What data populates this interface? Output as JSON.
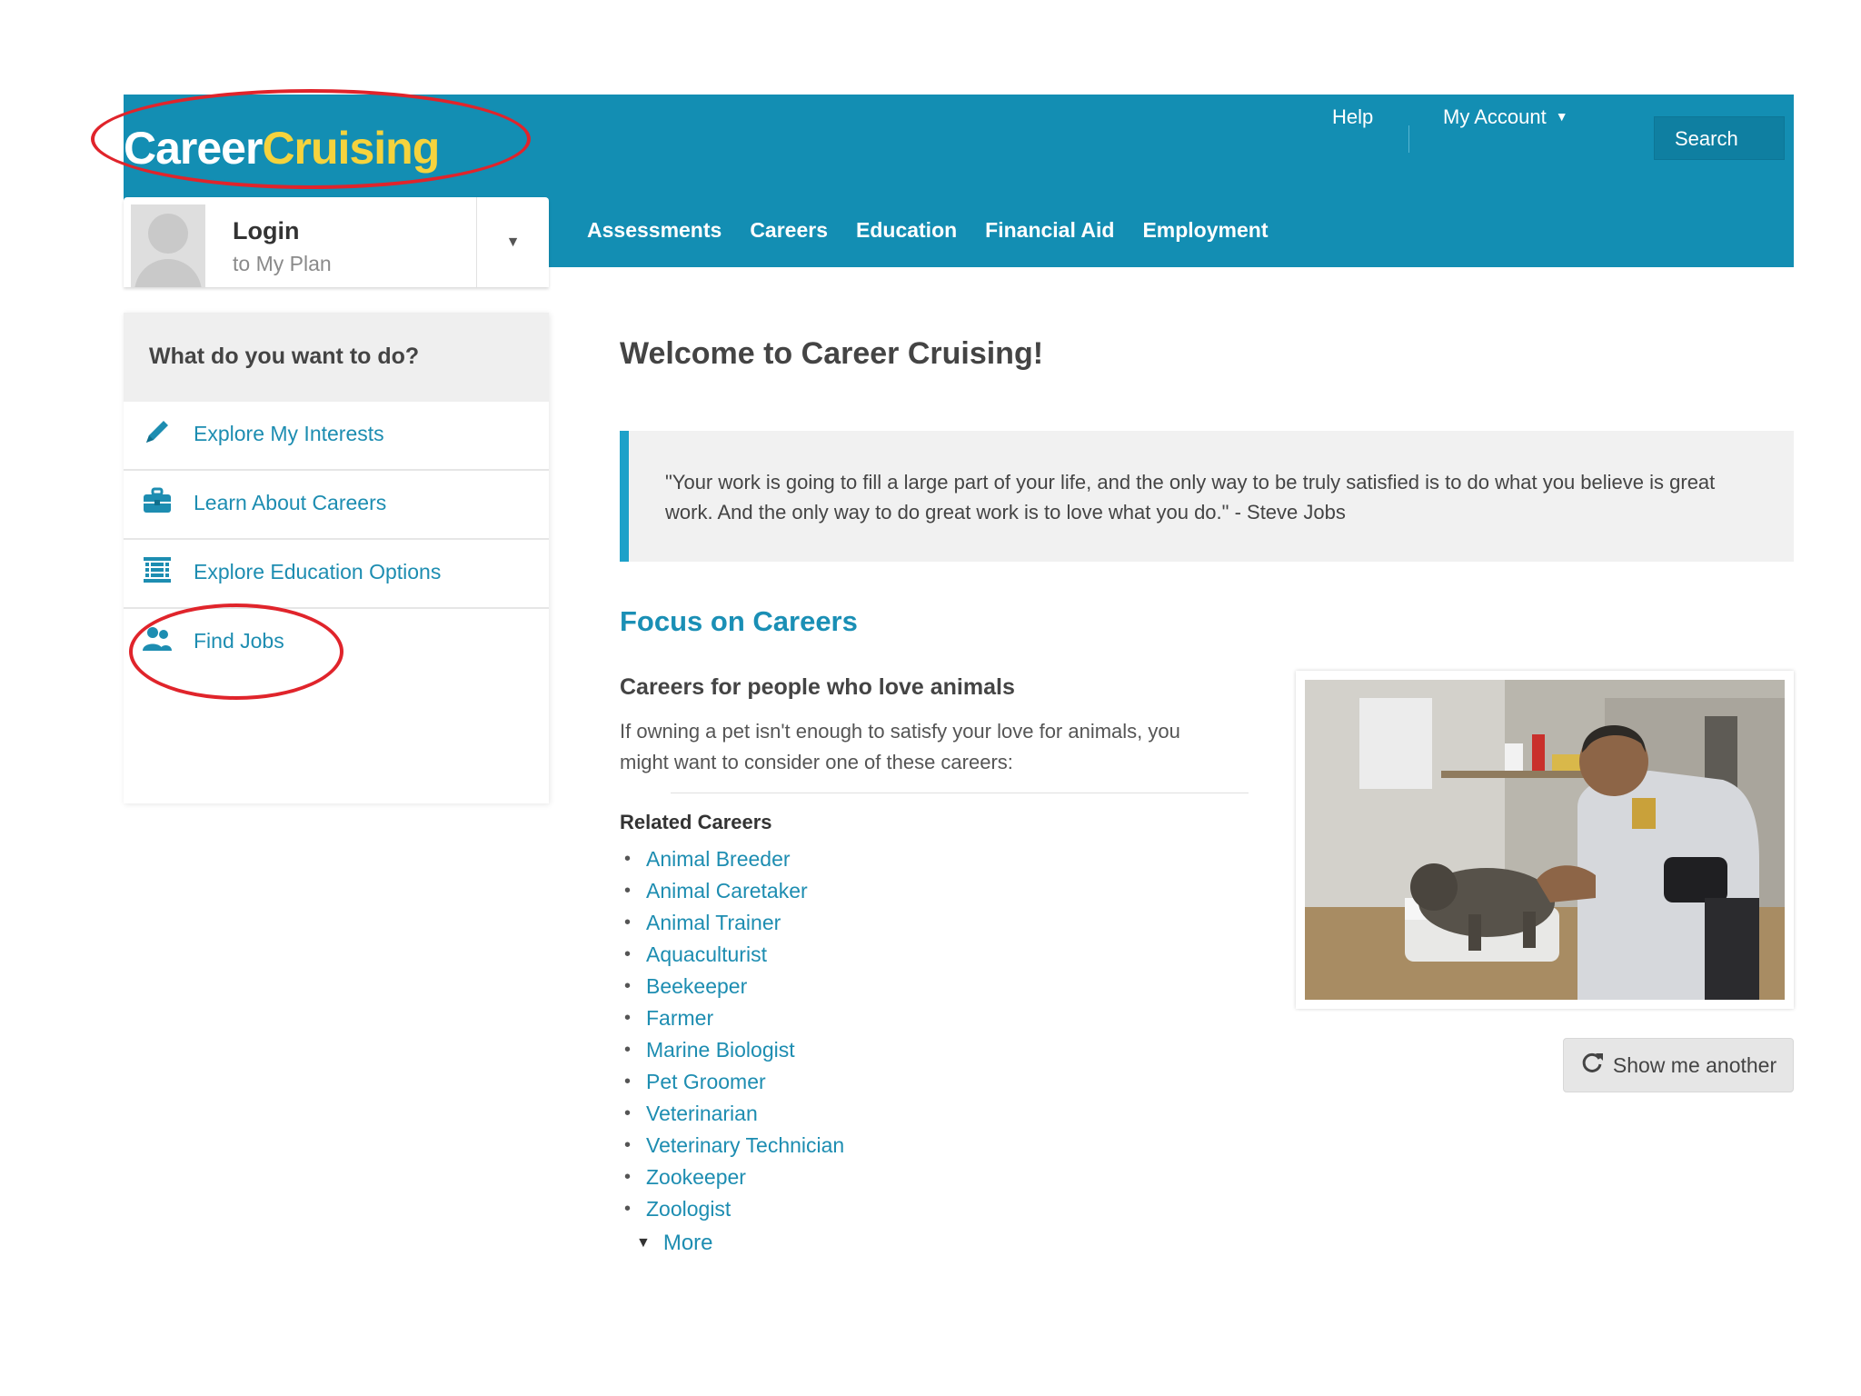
{
  "brand": {
    "logo_part1": "Career",
    "logo_part2": "Cruising",
    "primary_color": "#138eb3",
    "accent_color": "#f5d33d"
  },
  "topnav": {
    "help": "Help",
    "my_account": "My Account",
    "search": "Search"
  },
  "mainnav": [
    "Assessments",
    "Careers",
    "Education",
    "Financial Aid",
    "Employment"
  ],
  "login": {
    "title": "Login",
    "subtitle": "to My Plan"
  },
  "sidebar": {
    "heading": "What do you want to do?",
    "items": [
      {
        "label": "Explore My Interests",
        "icon": "pencil-icon"
      },
      {
        "label": "Learn About Careers",
        "icon": "briefcase-icon"
      },
      {
        "label": "Explore Education Options",
        "icon": "building-icon"
      },
      {
        "label": "Find Jobs",
        "icon": "people-icon"
      }
    ]
  },
  "main": {
    "welcome": "Welcome to Career Cruising!",
    "quote": "\"Your work is going to fill a large part of your life, and the only way to be truly satisfied is to do what you believe is great work. And the only way to do great work is to love what you do.\" - Steve Jobs",
    "focus_title": "Focus on Careers",
    "careers_title": "Careers for people who love animals",
    "careers_desc": "If owning a pet isn't enough to satisfy your love for animals, you might want to consider one of these careers:",
    "related_title": "Related Careers",
    "related_careers": [
      "Animal Breeder",
      "Animal Caretaker",
      "Animal Trainer",
      "Aquaculturist",
      "Beekeeper",
      "Farmer",
      "Marine Biologist",
      "Pet Groomer",
      "Veterinarian",
      "Veterinary Technician",
      "Zookeeper",
      "Zoologist"
    ],
    "more": "More",
    "show_another": "Show me another"
  },
  "annotation_color": "#e0242b"
}
